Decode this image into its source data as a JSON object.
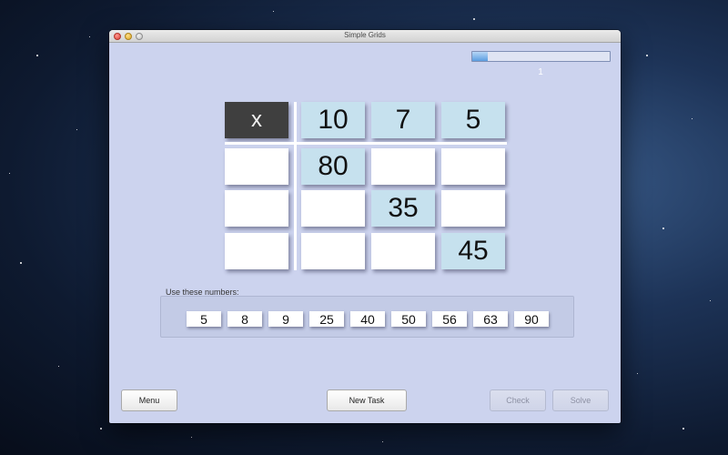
{
  "window": {
    "title": "Simple Grids"
  },
  "progress": {
    "fraction": 0.11,
    "counter": "1"
  },
  "grid": {
    "corner": "x",
    "headers": [
      "10",
      "7",
      "5"
    ],
    "rows": [
      [
        "",
        "80",
        "",
        ""
      ],
      [
        "",
        "",
        "35",
        ""
      ],
      [
        "",
        "",
        "",
        "45"
      ]
    ]
  },
  "numbers": {
    "label": "Use these numbers:",
    "items": [
      "5",
      "8",
      "9",
      "25",
      "40",
      "50",
      "56",
      "63",
      "90"
    ]
  },
  "buttons": {
    "menu": "Menu",
    "new_task": "New Task",
    "check": "Check",
    "solve": "Solve"
  }
}
